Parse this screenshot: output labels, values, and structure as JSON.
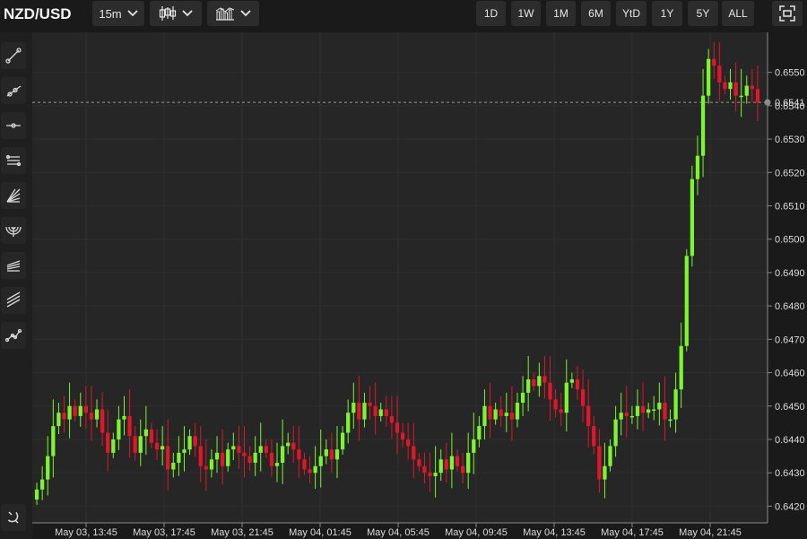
{
  "header": {
    "symbol": "NZD/USD",
    "interval": "15m",
    "chart_style_icon": "candlestick-icon",
    "indicators_icon": "bar-chart-icon",
    "ranges": [
      "1D",
      "1W",
      "1M",
      "6M",
      "YtD",
      "1Y",
      "5Y",
      "ALL"
    ],
    "fullscreen_icon": "fullscreen-icon"
  },
  "toolbar": {
    "tools": [
      "trend-line-icon",
      "ray-icon",
      "horizontal-line-icon",
      "parallel-channel-icon",
      "fan-icon",
      "arc-icon",
      "pitchfork-icon",
      "regression-channel-icon",
      "path-icon"
    ],
    "bottom_tool": "magnet-icon"
  },
  "colors": {
    "up": "#7cf531",
    "down": "#e0162b",
    "background": "#252625",
    "grid": "#2e302e"
  },
  "chart_data": {
    "type": "candlestick",
    "interval": "15m",
    "ylim": [
      0.6415,
      0.6562
    ],
    "yticks": [
      "0.6420",
      "0.6430",
      "0.6440",
      "0.6450",
      "0.6460",
      "0.6470",
      "0.6480",
      "0.6490",
      "0.6500",
      "0.6510",
      "0.6520",
      "0.6530",
      "0.6540",
      "0.6550"
    ],
    "xticks": [
      "May 03, 13:45",
      "May 03, 17:45",
      "May 03, 21:45",
      "May 04, 01:45",
      "May 04, 05:45",
      "May 04, 09:45",
      "May 04, 13:45",
      "May 04, 17:45",
      "May 04, 21:45"
    ],
    "last_price": "0.6541",
    "last_value": 0.6541,
    "ohlc_close": [
      0.6425,
      0.6428,
      0.6435,
      0.6444,
      0.6448,
      0.6446,
      0.645,
      0.6447,
      0.645,
      0.6448,
      0.6446,
      0.6449,
      0.6442,
      0.6436,
      0.644,
      0.6446,
      0.6447,
      0.6441,
      0.6436,
      0.6441,
      0.6443,
      0.6439,
      0.6437,
      0.6438,
      0.6431,
      0.6433,
      0.6436,
      0.6437,
      0.6441,
      0.6438,
      0.6432,
      0.6431,
      0.6434,
      0.6436,
      0.6432,
      0.6437,
      0.6438,
      0.6436,
      0.6435,
      0.6433,
      0.6436,
      0.6438,
      0.6436,
      0.6432,
      0.6433,
      0.6438,
      0.6439,
      0.6437,
      0.6434,
      0.6431,
      0.643,
      0.6432,
      0.6435,
      0.6437,
      0.6434,
      0.6437,
      0.6442,
      0.6448,
      0.6451,
      0.6446,
      0.6451,
      0.645,
      0.6447,
      0.6449,
      0.6447,
      0.6445,
      0.6442,
      0.644,
      0.6438,
      0.6434,
      0.6432,
      0.643,
      0.6429,
      0.643,
      0.6434,
      0.6431,
      0.6435,
      0.6432,
      0.643,
      0.6436,
      0.644,
      0.6444,
      0.645,
      0.6446,
      0.6449,
      0.6447,
      0.6448,
      0.6446,
      0.6451,
      0.6454,
      0.6458,
      0.6456,
      0.6459,
      0.6457,
      0.6452,
      0.6449,
      0.6448,
      0.6457,
      0.6458,
      0.6455,
      0.645,
      0.6444,
      0.6438,
      0.6428,
      0.6432,
      0.6438,
      0.6446,
      0.6448,
      0.6447,
      0.6447,
      0.645,
      0.6448,
      0.6449,
      0.6449,
      0.6451,
      0.6446,
      0.6446,
      0.6455,
      0.6468,
      0.6495,
      0.6518,
      0.6525,
      0.6543,
      0.6554,
      0.6552,
      0.6547,
      0.6545,
      0.6547,
      0.6543,
      0.6543,
      0.6546,
      0.6545,
      0.6541
    ]
  }
}
